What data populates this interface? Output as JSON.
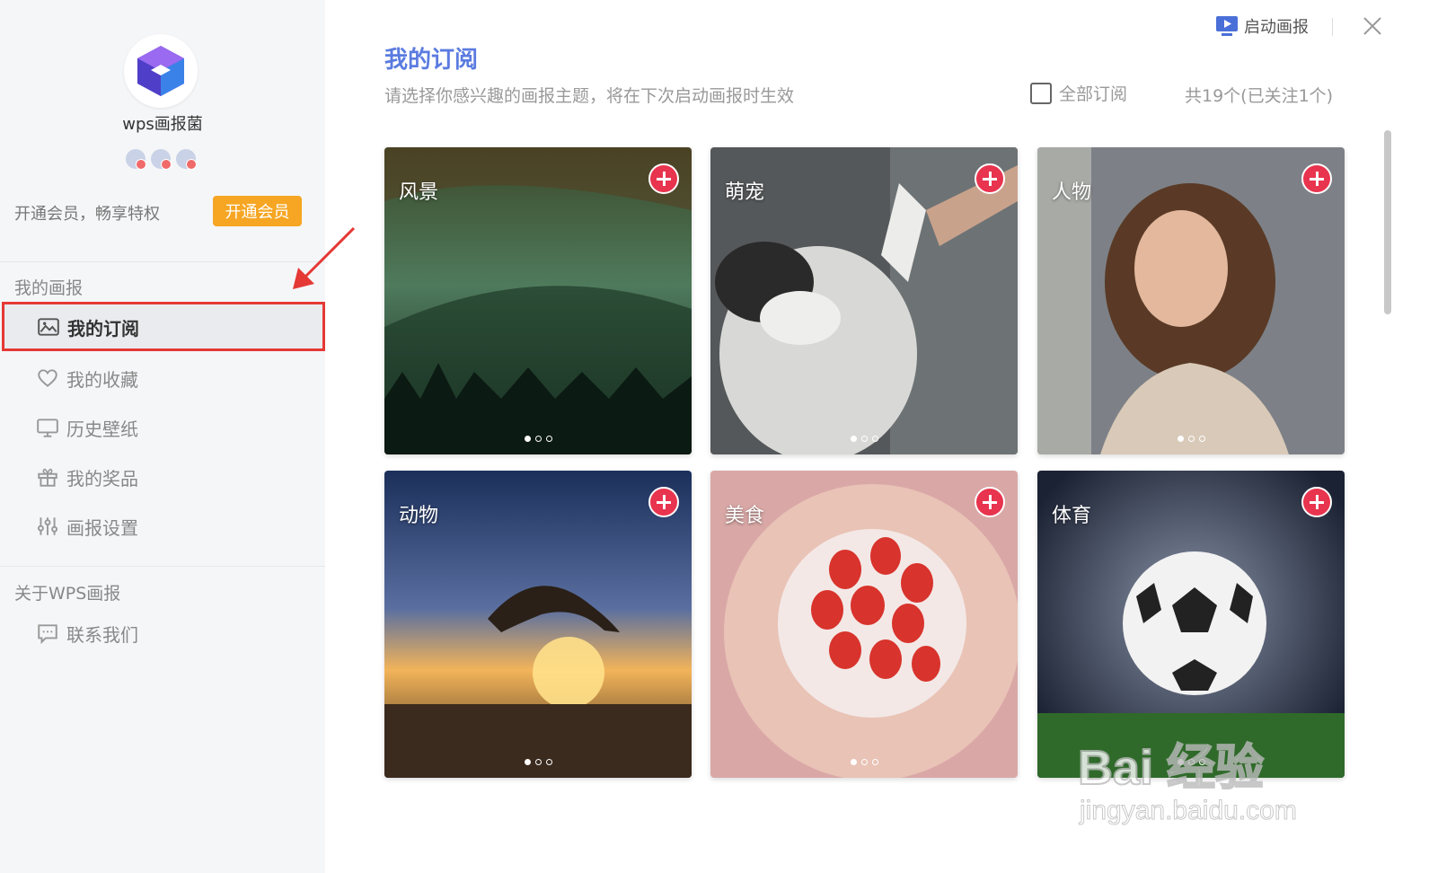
{
  "profile": {
    "username": "wps画报菌",
    "vip_text": "开通会员，畅享特权",
    "vip_button": "开通会员"
  },
  "sidebar": {
    "section_my": "我的画报",
    "items": [
      {
        "label": "我的订阅",
        "icon": "image-icon",
        "active": true
      },
      {
        "label": "我的收藏",
        "icon": "heart-icon",
        "active": false
      },
      {
        "label": "历史壁纸",
        "icon": "monitor-icon",
        "active": false
      },
      {
        "label": "我的奖品",
        "icon": "gift-icon",
        "active": false
      },
      {
        "label": "画报设置",
        "icon": "sliders-icon",
        "active": false
      }
    ],
    "section_about": "关于WPS画报",
    "contact": {
      "label": "联系我们",
      "icon": "message-icon"
    }
  },
  "header": {
    "launch_label": "启动画报",
    "title": "我的订阅",
    "subtitle": "请选择你感兴趣的画报主题，将在下次启动画报时生效",
    "subscribe_all": "全部订阅",
    "count": "共19个(已关注1个)"
  },
  "cards": [
    {
      "label": "风景",
      "theme": "landscape"
    },
    {
      "label": "萌宠",
      "theme": "pet"
    },
    {
      "label": "人物",
      "theme": "person"
    },
    {
      "label": "动物",
      "theme": "animal"
    },
    {
      "label": "美食",
      "theme": "food"
    },
    {
      "label": "体育",
      "theme": "sports"
    }
  ],
  "colors": {
    "accent": "#5b7be0",
    "vip": "#f6a623",
    "plus": "#e8344e",
    "highlight": "#e53935"
  },
  "watermark": {
    "main": "Bai 经验",
    "sub": "jingyan.baidu.com"
  }
}
